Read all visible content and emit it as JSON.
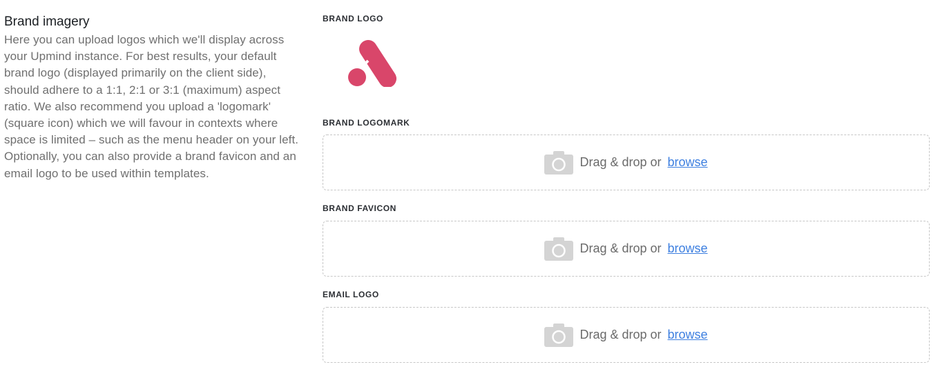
{
  "section": {
    "title": "Brand imagery",
    "description": "Here you can upload logos which we'll display across your Upmind instance. For best results, your default brand logo (displayed primarily on the client side), should adhere to a 1:1, 2:1 or 3:1 (maximum) aspect ratio. We also recommend you upload a 'logomark' (square icon) which we will favour in contexts where space is limited – such as the menu header on your left. Optionally, you can also provide a brand favicon and an email logo to be used within templates."
  },
  "fields": {
    "brand_logo": {
      "label": "BRAND LOGO",
      "logo_icon": "upmind-logo"
    },
    "logomark": {
      "label": "BRAND LOGOMARK",
      "prompt": "Drag & drop or",
      "link": "browse",
      "icon": "camera-icon"
    },
    "favicon": {
      "label": "BRAND FAVICON",
      "prompt": "Drag & drop or",
      "link": "browse",
      "icon": "camera-icon"
    },
    "email_logo": {
      "label": "EMAIL LOGO",
      "prompt": "Drag & drop or",
      "link": "browse",
      "icon": "camera-icon"
    }
  },
  "colors": {
    "logo": "#d9466a",
    "link": "#3d7fe0",
    "dashed_border": "#c6c6c6",
    "camera_icon": "#d4d4d4"
  }
}
